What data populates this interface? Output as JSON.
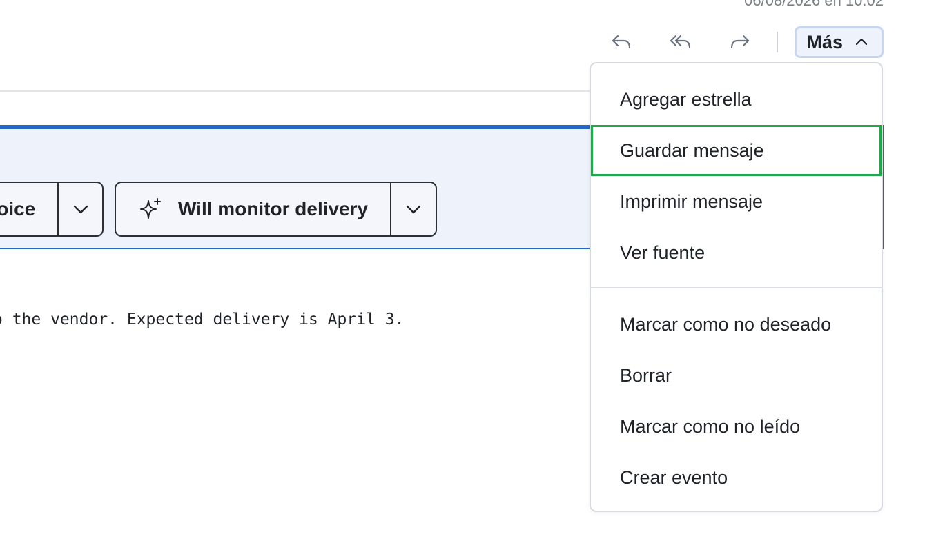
{
  "header": {
    "timestamp": "06/08/2026 en 10:02",
    "more_label": "Más"
  },
  "banner": {
    "invoice_label": "oice",
    "monitor_label": "Will monitor delivery"
  },
  "message": {
    "body_line": "o the vendor. Expected delivery is April 3."
  },
  "more_menu": {
    "items": [
      "Agregar estrella",
      "Guardar mensaje",
      "Imprimir mensaje",
      "Ver fuente",
      "Marcar como no deseado",
      "Borrar",
      "Marcar como no leído",
      "Crear evento"
    ],
    "highlighted": "Guardar mensaje"
  },
  "colors": {
    "accent": "#2467c4",
    "highlight_border": "#1fa84a",
    "banner_bg": "#eef2fa"
  },
  "icons": [
    "reply-icon",
    "reply-all-icon",
    "forward-icon",
    "chevron-up-icon",
    "chevron-down-icon",
    "sparkle-icon"
  ]
}
